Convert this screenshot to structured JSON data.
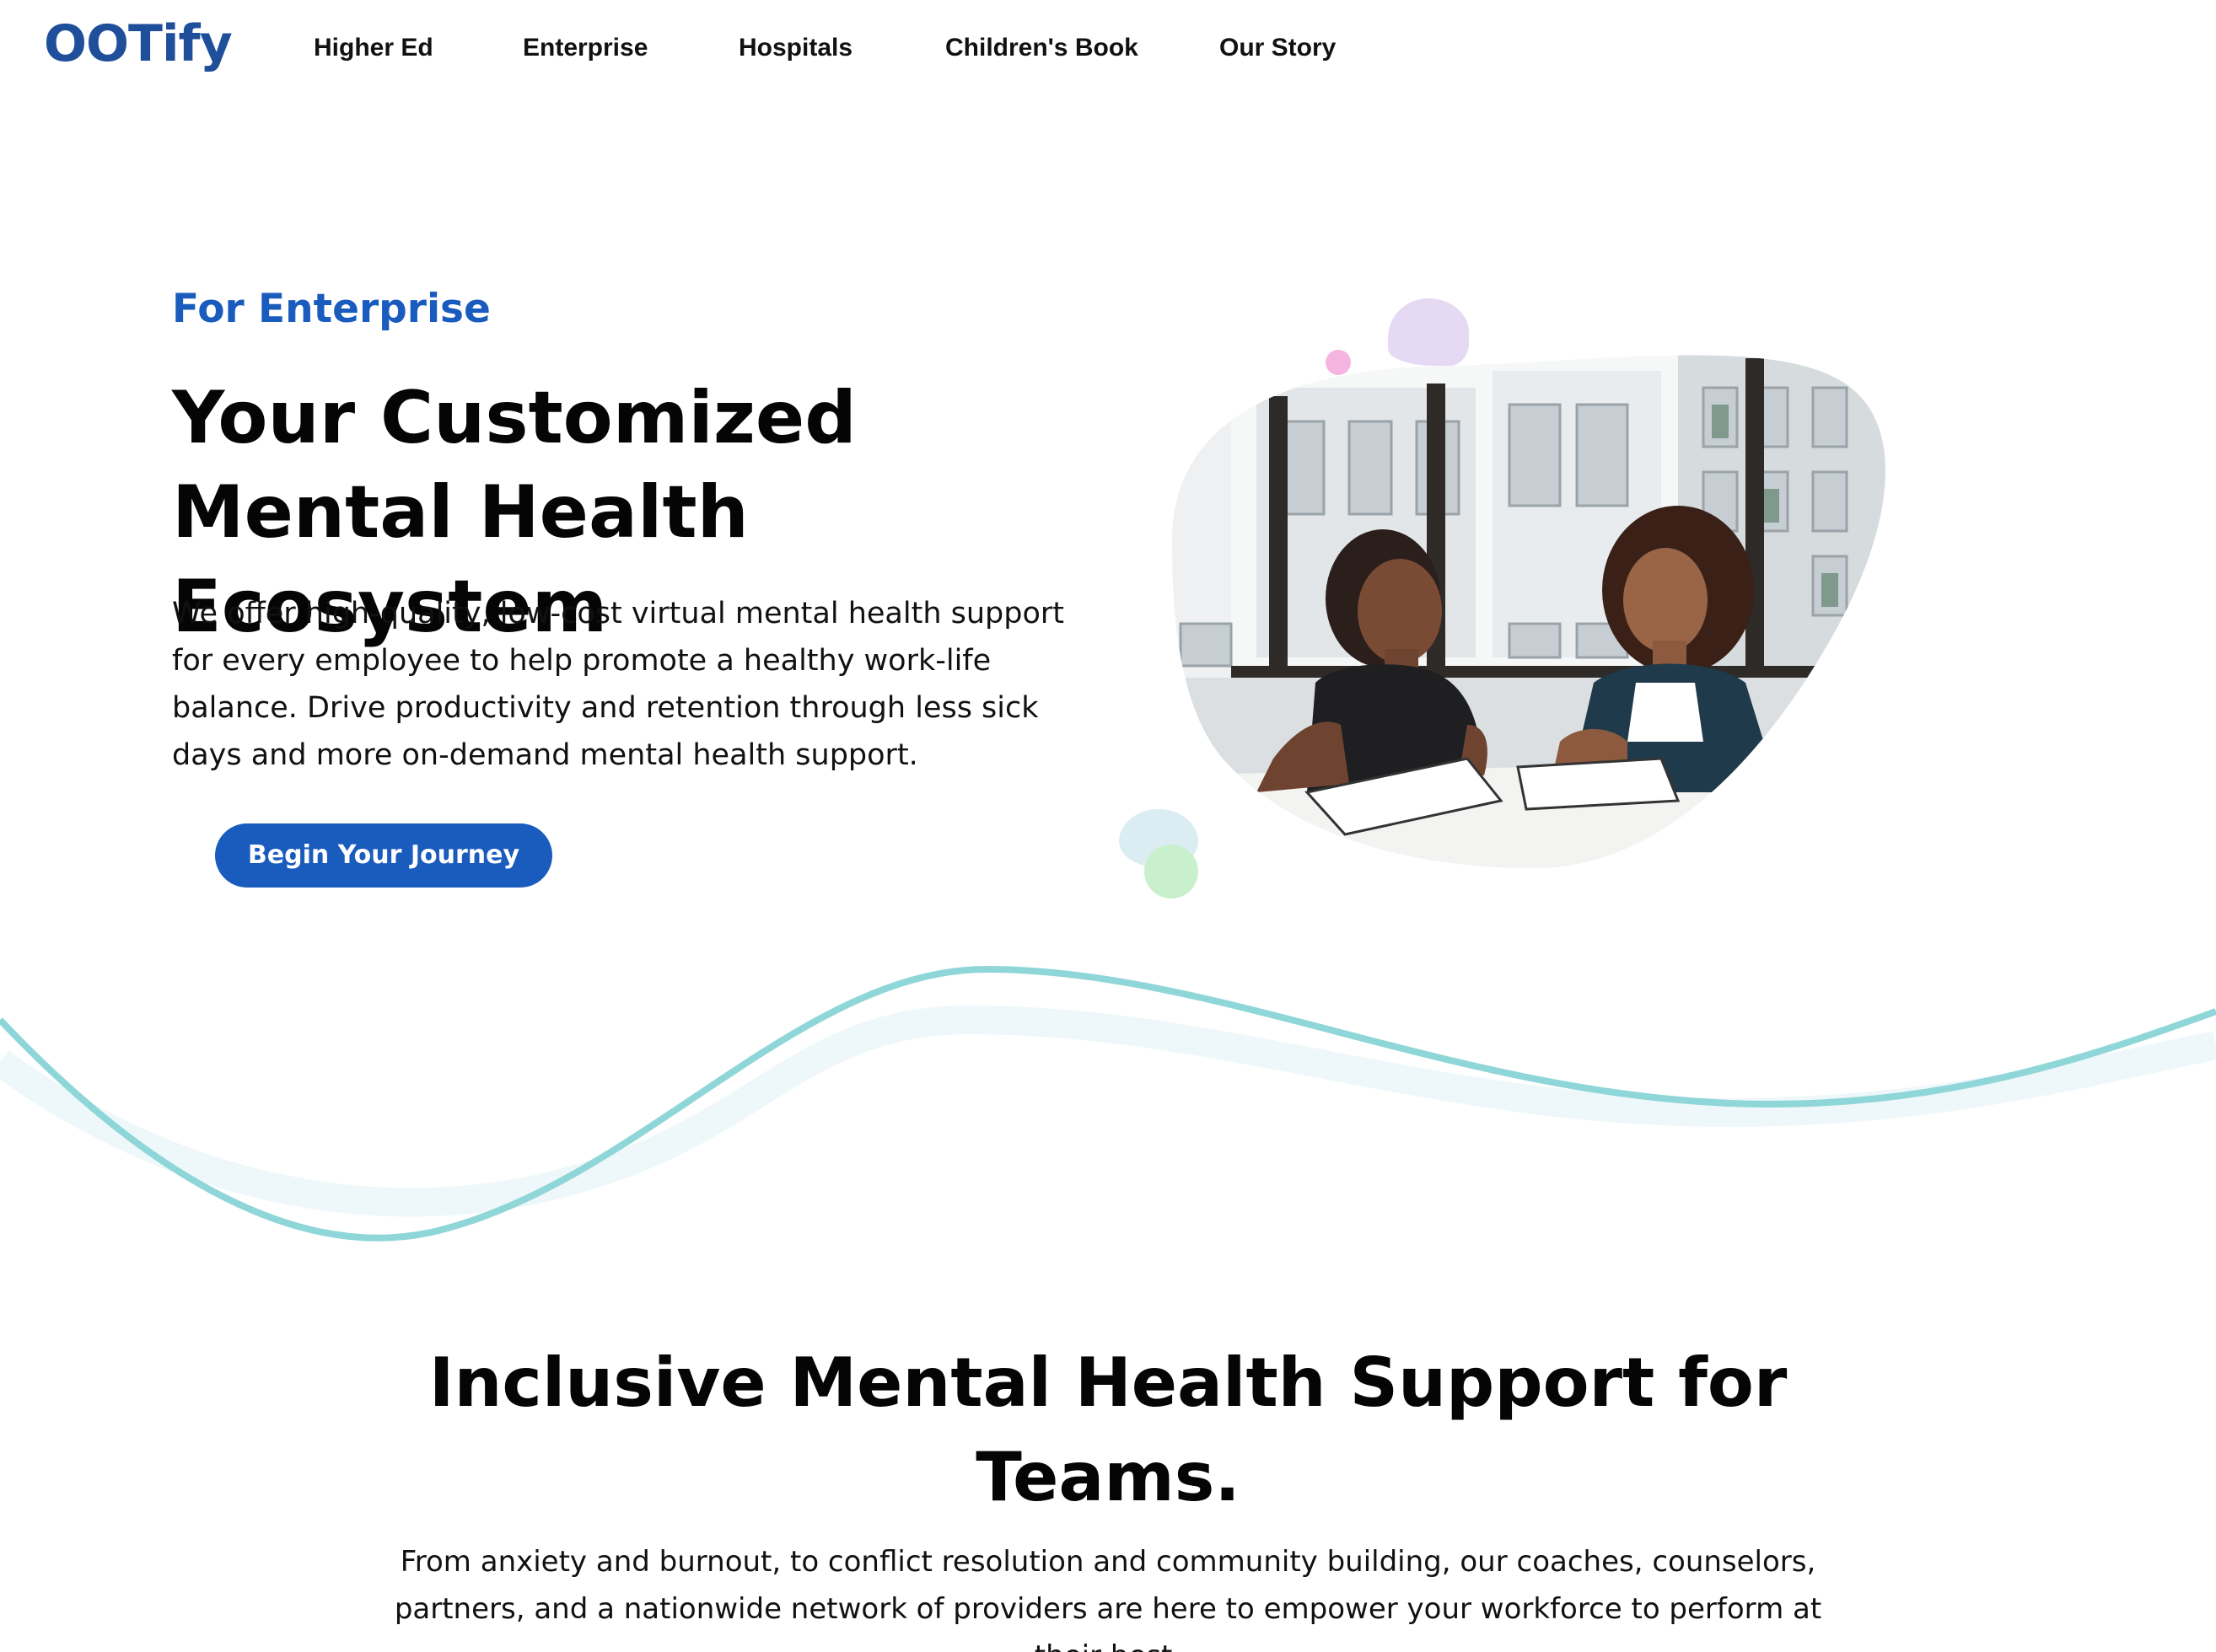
{
  "nav": {
    "logo": "OOTify",
    "links": [
      "Higher Ed",
      "Enterprise",
      "Hospitals",
      "Children's Book",
      "Our Story"
    ]
  },
  "hero": {
    "eyebrow": "For Enterprise",
    "title": "Your Customized Mental Health Ecosystem",
    "body": "We offer high-quality, low-cost virtual mental health support for every employee to help promote a healthy work-life balance. Drive productivity and retention through less sick days and more on-demand mental health support.",
    "cta_label": "Begin Your Journey",
    "image_alt": "Two women talking at a table in an office"
  },
  "section": {
    "title": "Inclusive Mental Health Support for Teams.",
    "body": "From anxiety and burnout, to conflict resolution and community building, our coaches, counselors, partners, and a nationwide network of providers are here to empower your workforce to perform at their best."
  },
  "colors": {
    "brand_blue": "#1a5bbe",
    "logo_blue": "#1f4e9a",
    "wave_teal": "#8fd6d8",
    "wave_light": "#eef7f9"
  }
}
